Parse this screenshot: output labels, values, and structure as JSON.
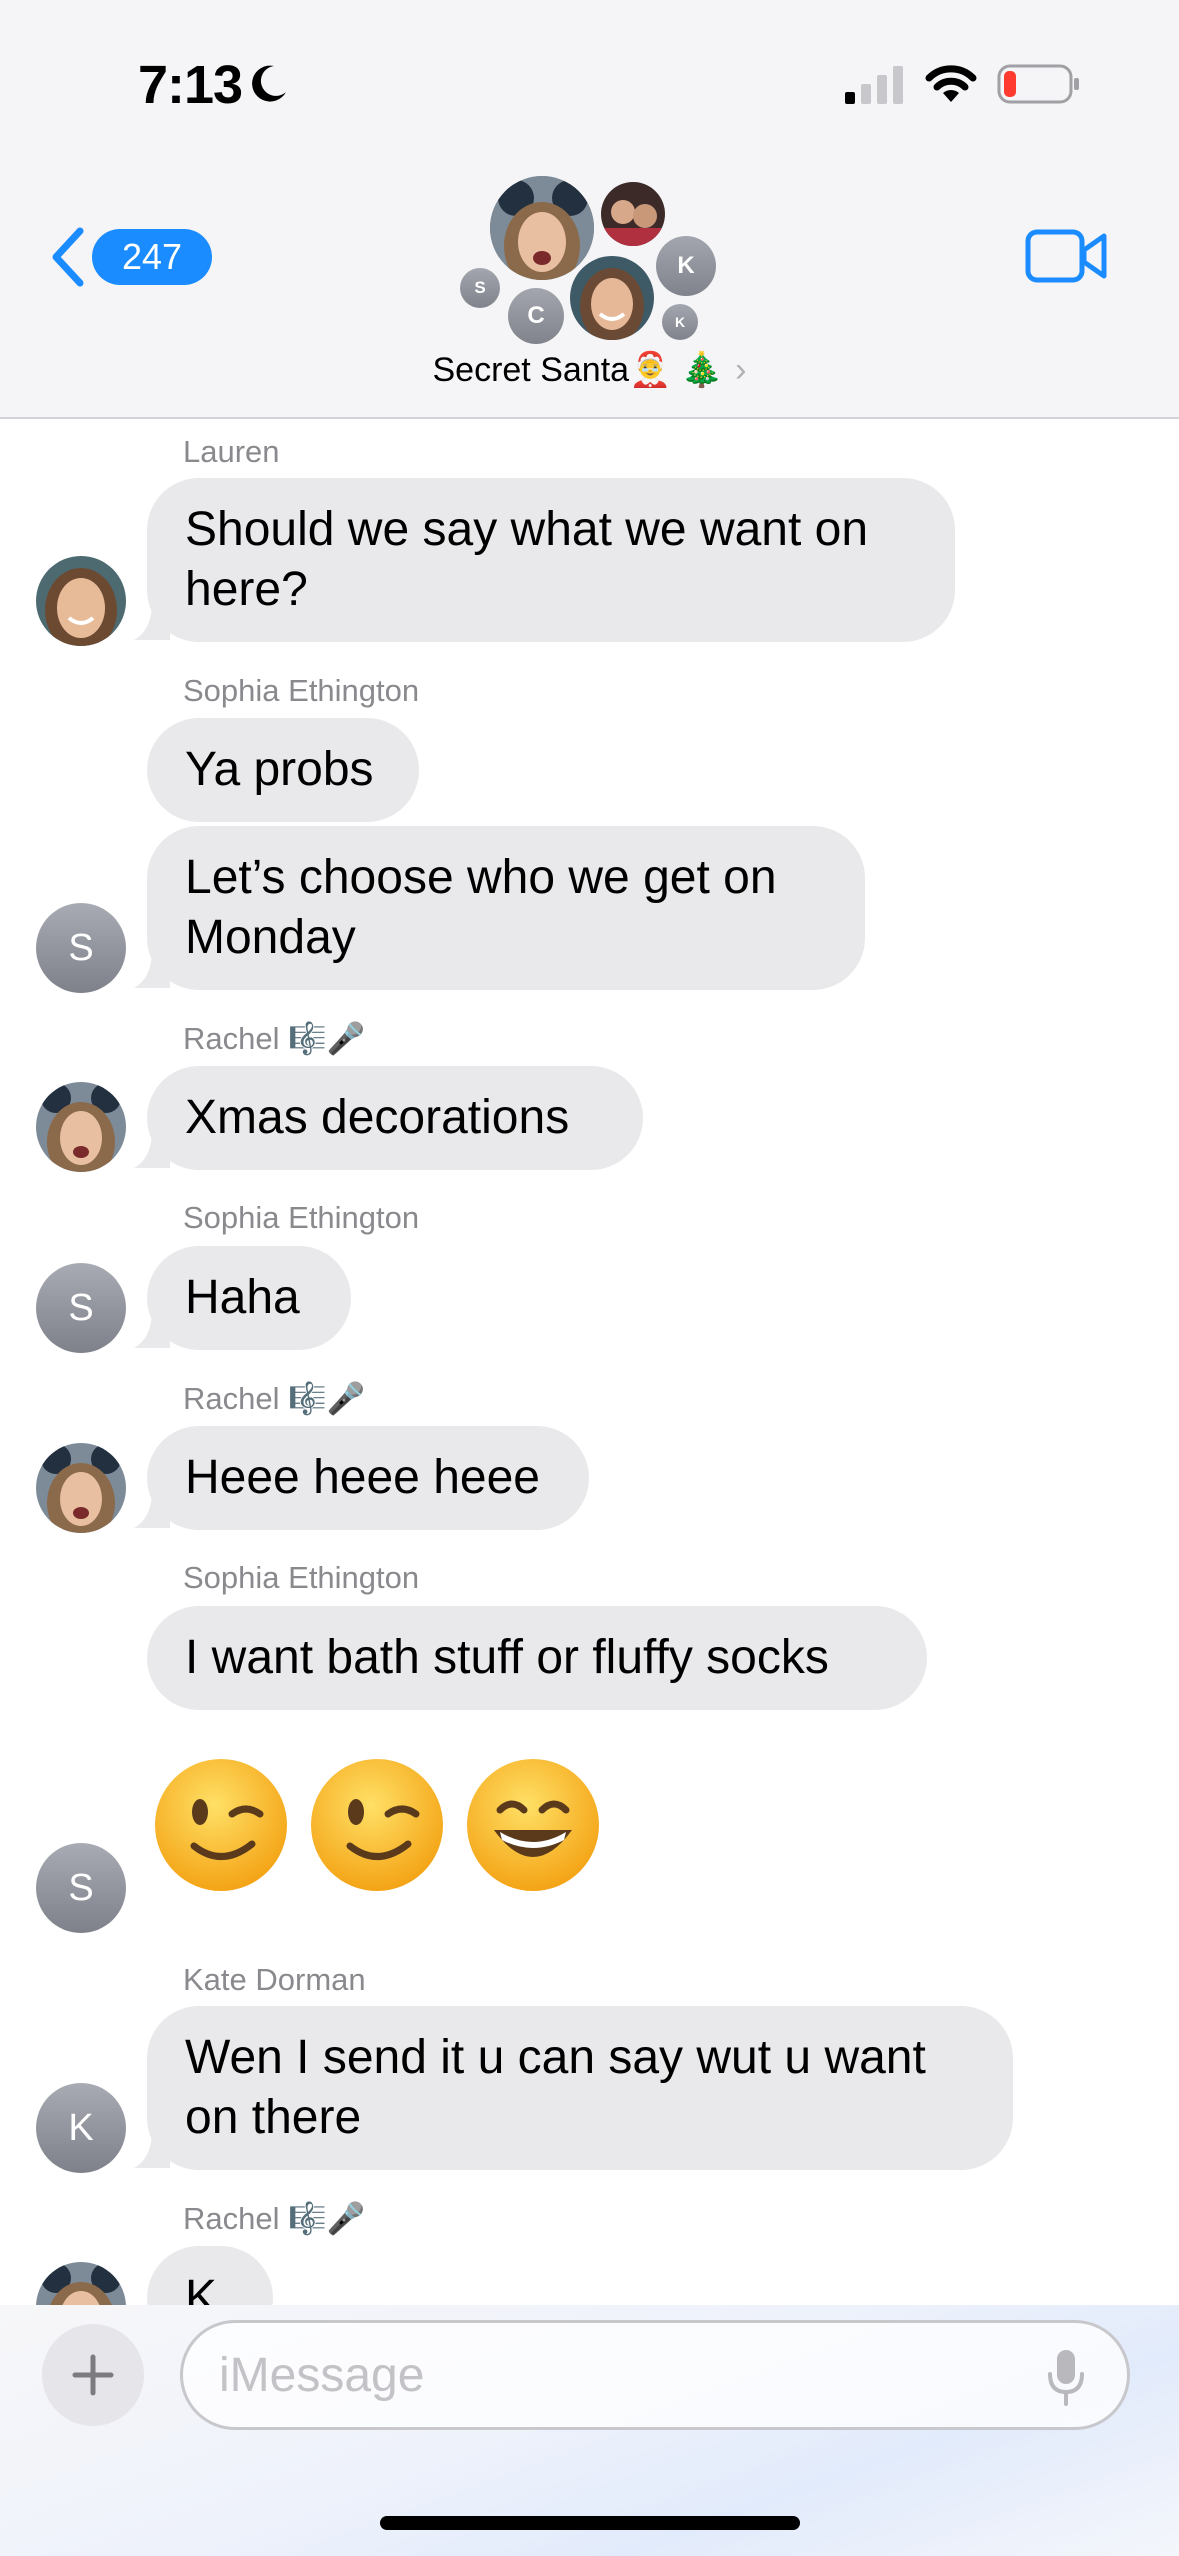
{
  "status_bar": {
    "time": "7:13"
  },
  "header": {
    "back_count": "247",
    "group_name": "Secret Santa🤶 🎄",
    "chevron": "›",
    "avatar_letters": [
      "S",
      "C",
      "K",
      "K"
    ]
  },
  "messages": [
    {
      "sender": "Lauren",
      "bubbles": [
        "Should we say what we want on here?"
      ]
    },
    {
      "sender": "Sophia Ethington",
      "bubbles": [
        "Ya probs",
        "Let’s choose who we get on Monday"
      ],
      "avatar_letter": "S"
    },
    {
      "sender": "Rachel 🎼🎤",
      "bubbles": [
        "Xmas decorations"
      ]
    },
    {
      "sender": "Sophia Ethington",
      "bubbles": [
        "Haha"
      ],
      "avatar_letter": "S"
    },
    {
      "sender": "Rachel 🎼🎤",
      "bubbles": [
        "Heee heee heee"
      ]
    },
    {
      "sender": "Sophia Ethington",
      "bubbles": [
        "I want bath stuff or fluffy socks"
      ],
      "avatar_letter": "S"
    },
    {
      "sender": "Kate Dorman",
      "bubbles": [
        "Wen I send it u can say wut u want on there"
      ],
      "avatar_letter": "K"
    },
    {
      "sender": "Rachel 🎼🎤",
      "bubbles": [
        "K"
      ]
    }
  ],
  "emoji_message": {
    "faces": [
      "winking-face",
      "winking-face",
      "grinning-face"
    ]
  },
  "compose": {
    "placeholder": "iMessage"
  },
  "colors": {
    "accent": "#1a8cff",
    "bubble": "#e9e9eb",
    "battery_low": "#ff3b30"
  }
}
